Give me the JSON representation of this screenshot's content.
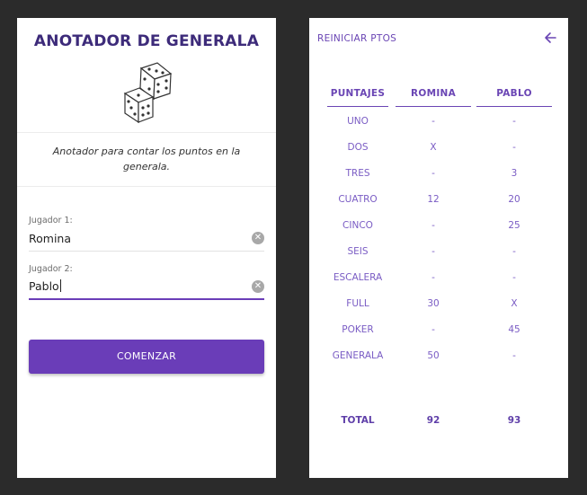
{
  "setup": {
    "title": "ANOTADOR DE GENERALA",
    "description": "Anotador para contar los puntos en la generala.",
    "player1_label": "Jugador 1:",
    "player1_value": "Romina",
    "player2_label": "Jugador 2:",
    "player2_value": "Pablo",
    "clear_glyph": "✕",
    "start_button": "COMENZAR",
    "icons": [
      "dice-icon",
      "clear-icon"
    ],
    "colors": {
      "title": "#3d2b7a",
      "accent": "#6a3db8"
    }
  },
  "scoreboard": {
    "reset_label": "REINICIAR PTOS",
    "back_icon": "arrow-left-icon",
    "headers": [
      "PUNTAJES",
      "ROMINA",
      "PABLO"
    ],
    "rows": [
      {
        "category": "UNO",
        "romina": "-",
        "pablo": "-"
      },
      {
        "category": "DOS",
        "romina": "X",
        "pablo": "-"
      },
      {
        "category": "TRES",
        "romina": "-",
        "pablo": "3"
      },
      {
        "category": "CUATRO",
        "romina": "12",
        "pablo": "20"
      },
      {
        "category": "CINCO",
        "romina": "-",
        "pablo": "25"
      },
      {
        "category": "SEIS",
        "romina": "-",
        "pablo": "-"
      },
      {
        "category": "ESCALERA",
        "romina": "-",
        "pablo": "-"
      },
      {
        "category": "FULL",
        "romina": "30",
        "pablo": "X"
      },
      {
        "category": "POKER",
        "romina": "-",
        "pablo": "45"
      },
      {
        "category": "GENERALA",
        "romina": "50",
        "pablo": "-"
      }
    ],
    "total": {
      "label": "TOTAL",
      "romina": "92",
      "pablo": "93"
    }
  }
}
